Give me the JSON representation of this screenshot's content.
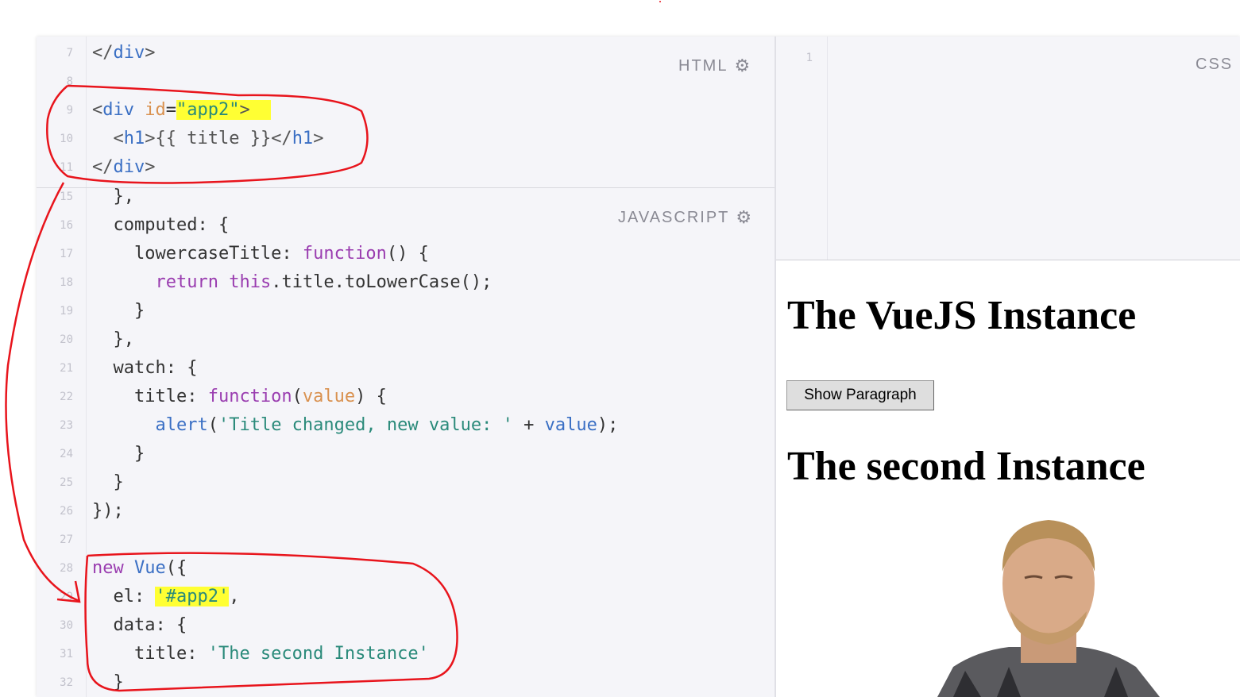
{
  "html_editor": {
    "label": "HTML",
    "gear_icon": "gear-icon",
    "lines": [
      {
        "num": "7",
        "segments": [
          {
            "t": "</",
            "c": "tag"
          },
          {
            "t": "div",
            "c": "tn"
          },
          {
            "t": ">",
            "c": "tag"
          }
        ]
      },
      {
        "num": "8",
        "segments": []
      },
      {
        "num": "9",
        "segments": [
          {
            "t": "<",
            "c": "tag"
          },
          {
            "t": "div",
            "c": "tn"
          },
          {
            "t": " "
          },
          {
            "t": "id",
            "c": "attr"
          },
          {
            "t": "="
          },
          {
            "t": "\"app2\"",
            "c": "str hl"
          },
          {
            "t": ">",
            "c": "tag hl"
          },
          {
            "t": "  ",
            "c": "hl"
          }
        ]
      },
      {
        "num": "10",
        "segments": [
          {
            "t": "  <",
            "c": "tag"
          },
          {
            "t": "h1",
            "c": "tn"
          },
          {
            "t": ">{{ title }}</",
            "c": "tag"
          },
          {
            "t": "h1",
            "c": "tn"
          },
          {
            "t": ">",
            "c": "tag"
          }
        ]
      },
      {
        "num": "11",
        "segments": [
          {
            "t": "</",
            "c": "tag"
          },
          {
            "t": "div",
            "c": "tn"
          },
          {
            "t": ">",
            "c": "tag"
          }
        ]
      }
    ]
  },
  "js_editor": {
    "label": "JAVASCRIPT",
    "gear_icon": "gear-icon",
    "lines": [
      {
        "num": "15",
        "segments": [
          {
            "t": "  },"
          }
        ]
      },
      {
        "num": "16",
        "segments": [
          {
            "t": "  computed: {"
          }
        ]
      },
      {
        "num": "17",
        "segments": [
          {
            "t": "    lowercaseTitle: "
          },
          {
            "t": "function",
            "c": "kw"
          },
          {
            "t": "() {"
          }
        ]
      },
      {
        "num": "18",
        "segments": [
          {
            "t": "      "
          },
          {
            "t": "return",
            "c": "kw"
          },
          {
            "t": " "
          },
          {
            "t": "this",
            "c": "kw"
          },
          {
            "t": ".title.toLowerCase();"
          }
        ]
      },
      {
        "num": "19",
        "segments": [
          {
            "t": "    }"
          }
        ]
      },
      {
        "num": "20",
        "segments": [
          {
            "t": "  },"
          }
        ]
      },
      {
        "num": "21",
        "segments": [
          {
            "t": "  watch: {"
          }
        ]
      },
      {
        "num": "22",
        "segments": [
          {
            "t": "    title: "
          },
          {
            "t": "function",
            "c": "kw"
          },
          {
            "t": "("
          },
          {
            "t": "value",
            "c": "prm"
          },
          {
            "t": ") {"
          }
        ]
      },
      {
        "num": "23",
        "segments": [
          {
            "t": "      "
          },
          {
            "t": "alert",
            "c": "fn"
          },
          {
            "t": "("
          },
          {
            "t": "'Title changed, new value: '",
            "c": "str"
          },
          {
            "t": " + "
          },
          {
            "t": "value",
            "c": "fn"
          },
          {
            "t": ");"
          }
        ]
      },
      {
        "num": "24",
        "segments": [
          {
            "t": "    }"
          }
        ]
      },
      {
        "num": "25",
        "segments": [
          {
            "t": "  }"
          }
        ]
      },
      {
        "num": "26",
        "segments": [
          {
            "t": "});"
          }
        ]
      },
      {
        "num": "27",
        "segments": []
      },
      {
        "num": "28",
        "segments": [
          {
            "t": "new",
            "c": "kw"
          },
          {
            "t": " "
          },
          {
            "t": "Vue",
            "c": "fn"
          },
          {
            "t": "({"
          }
        ]
      },
      {
        "num": "29",
        "segments": [
          {
            "t": "  el: "
          },
          {
            "t": "'#app2'",
            "c": "str hl"
          },
          {
            "t": ","
          }
        ]
      },
      {
        "num": "30",
        "segments": [
          {
            "t": "  data: {"
          }
        ]
      },
      {
        "num": "31",
        "segments": [
          {
            "t": "    title: "
          },
          {
            "t": "'The second Instance'",
            "c": "str"
          }
        ]
      },
      {
        "num": "32",
        "segments": [
          {
            "t": "  }"
          }
        ]
      }
    ]
  },
  "css_editor": {
    "label": "CSS",
    "lines": [
      {
        "num": "1"
      }
    ]
  },
  "preview": {
    "heading1": "The VueJS Instance",
    "button_label": "Show Paragraph",
    "heading2": "The second Instance"
  },
  "colors": {
    "annotation": "#e8141c",
    "highlight": "#ffff33",
    "editor_bg": "#f5f5f9"
  }
}
